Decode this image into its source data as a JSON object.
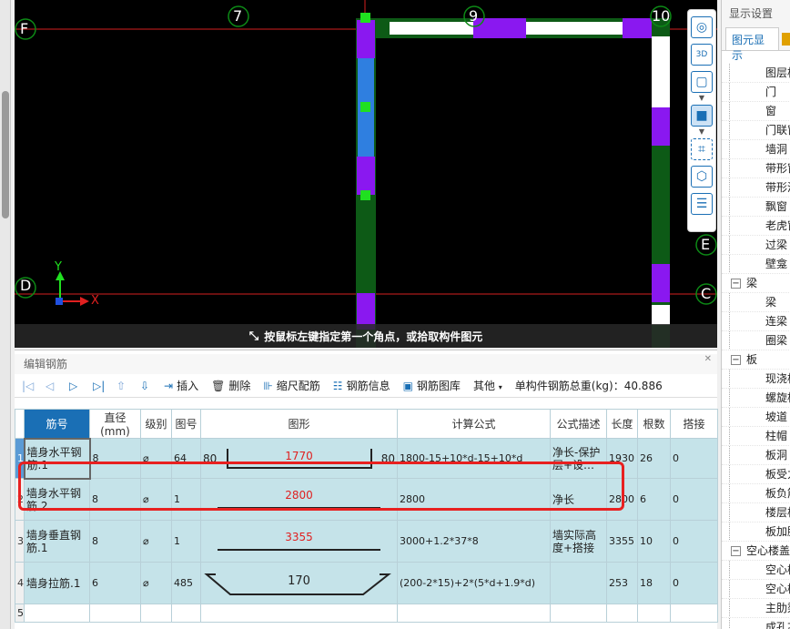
{
  "canvas": {
    "axis_labels": [
      "7",
      "9",
      "10"
    ],
    "row_labels": [
      "F",
      "E",
      "D",
      "C"
    ],
    "coord_x": "X",
    "coord_y": "Y",
    "status_hint": "按鼠标左键指定第一个角点，或拾取构件图元"
  },
  "view_toolbar": {
    "items": [
      "orbit-icon",
      "3d-view-icon",
      "box-view-icon",
      "solid-view-icon",
      "select-area-icon",
      "cube-filter-icon",
      "properties-icon"
    ]
  },
  "right_panel": {
    "title": "显示设置",
    "tab": "图元显示",
    "tree": [
      {
        "label": "图层构",
        "type": "child"
      },
      {
        "label": "门",
        "type": "child"
      },
      {
        "label": "窗",
        "type": "child"
      },
      {
        "label": "门联窗",
        "type": "child"
      },
      {
        "label": "墙洞",
        "type": "child"
      },
      {
        "label": "带形窗",
        "type": "child"
      },
      {
        "label": "带形洞",
        "type": "child"
      },
      {
        "label": "飘窗",
        "type": "child"
      },
      {
        "label": "老虎窗",
        "type": "child"
      },
      {
        "label": "过梁",
        "type": "child"
      },
      {
        "label": "壁龛",
        "type": "child"
      },
      {
        "label": "梁",
        "type": "parent"
      },
      {
        "label": "梁",
        "type": "child"
      },
      {
        "label": "连梁",
        "type": "child"
      },
      {
        "label": "圈梁",
        "type": "child"
      },
      {
        "label": "板",
        "type": "parent"
      },
      {
        "label": "现浇板",
        "type": "child"
      },
      {
        "label": "螺旋板",
        "type": "child"
      },
      {
        "label": "坡道",
        "type": "child"
      },
      {
        "label": "柱帽",
        "type": "child"
      },
      {
        "label": "板洞",
        "type": "child"
      },
      {
        "label": "板受力",
        "type": "child"
      },
      {
        "label": "板负筋",
        "type": "child"
      },
      {
        "label": "楼层板",
        "type": "child"
      },
      {
        "label": "板加腋",
        "type": "child"
      },
      {
        "label": "空心楼盖",
        "type": "parent"
      },
      {
        "label": "空心楼",
        "type": "child"
      },
      {
        "label": "空心楼",
        "type": "child"
      },
      {
        "label": "主肋梁",
        "type": "child"
      },
      {
        "label": "成孔芯",
        "type": "child"
      }
    ]
  },
  "bottom_panel": {
    "title": "编辑钢筋",
    "toolbar": {
      "insert": "插入",
      "delete": "删除",
      "scale_rebar": "缩尺配筋",
      "rebar_info": "钢筋信息",
      "rebar_library": "钢筋图库",
      "other": "其他",
      "total": "单构件钢筋总重(kg)：40.886"
    },
    "columns": [
      "筋号",
      "直径(mm)",
      "级别",
      "图号",
      "图形",
      "计算公式",
      "公式描述",
      "长度",
      "根数",
      "搭接"
    ],
    "rows": [
      {
        "no": "1",
        "name": "墙身水平钢筋.1",
        "dia": "8",
        "grade": "⌀",
        "fig": "64",
        "shape_left": "80",
        "shape_mid": "1770",
        "shape_right": "80",
        "formula": "1800-15+10*d-15+10*d",
        "desc": "净长-保护层+设…",
        "len": "1930",
        "count": "26",
        "lap": "0"
      },
      {
        "no": "2",
        "name": "墙身水平钢筋.2",
        "dia": "8",
        "grade": "⌀",
        "fig": "1",
        "shape_mid": "2800",
        "formula": "2800",
        "desc": "净长",
        "len": "2800",
        "count": "6",
        "lap": "0"
      },
      {
        "no": "3",
        "name": "墙身垂直钢筋.1",
        "dia": "8",
        "grade": "⌀",
        "fig": "1",
        "shape_mid": "3355",
        "formula": "3000+1.2*37*8",
        "desc": "墙实际高度+搭接",
        "len": "3355",
        "count": "10",
        "lap": "0"
      },
      {
        "no": "4",
        "name": "墙身拉筋.1",
        "dia": "6",
        "grade": "⌀",
        "fig": "485",
        "shape_mid": "170",
        "formula": "(200-2*15)+2*(5*d+1.9*d)",
        "desc": "",
        "len": "253",
        "count": "18",
        "lap": "0"
      }
    ],
    "empty_row_no": "5"
  }
}
